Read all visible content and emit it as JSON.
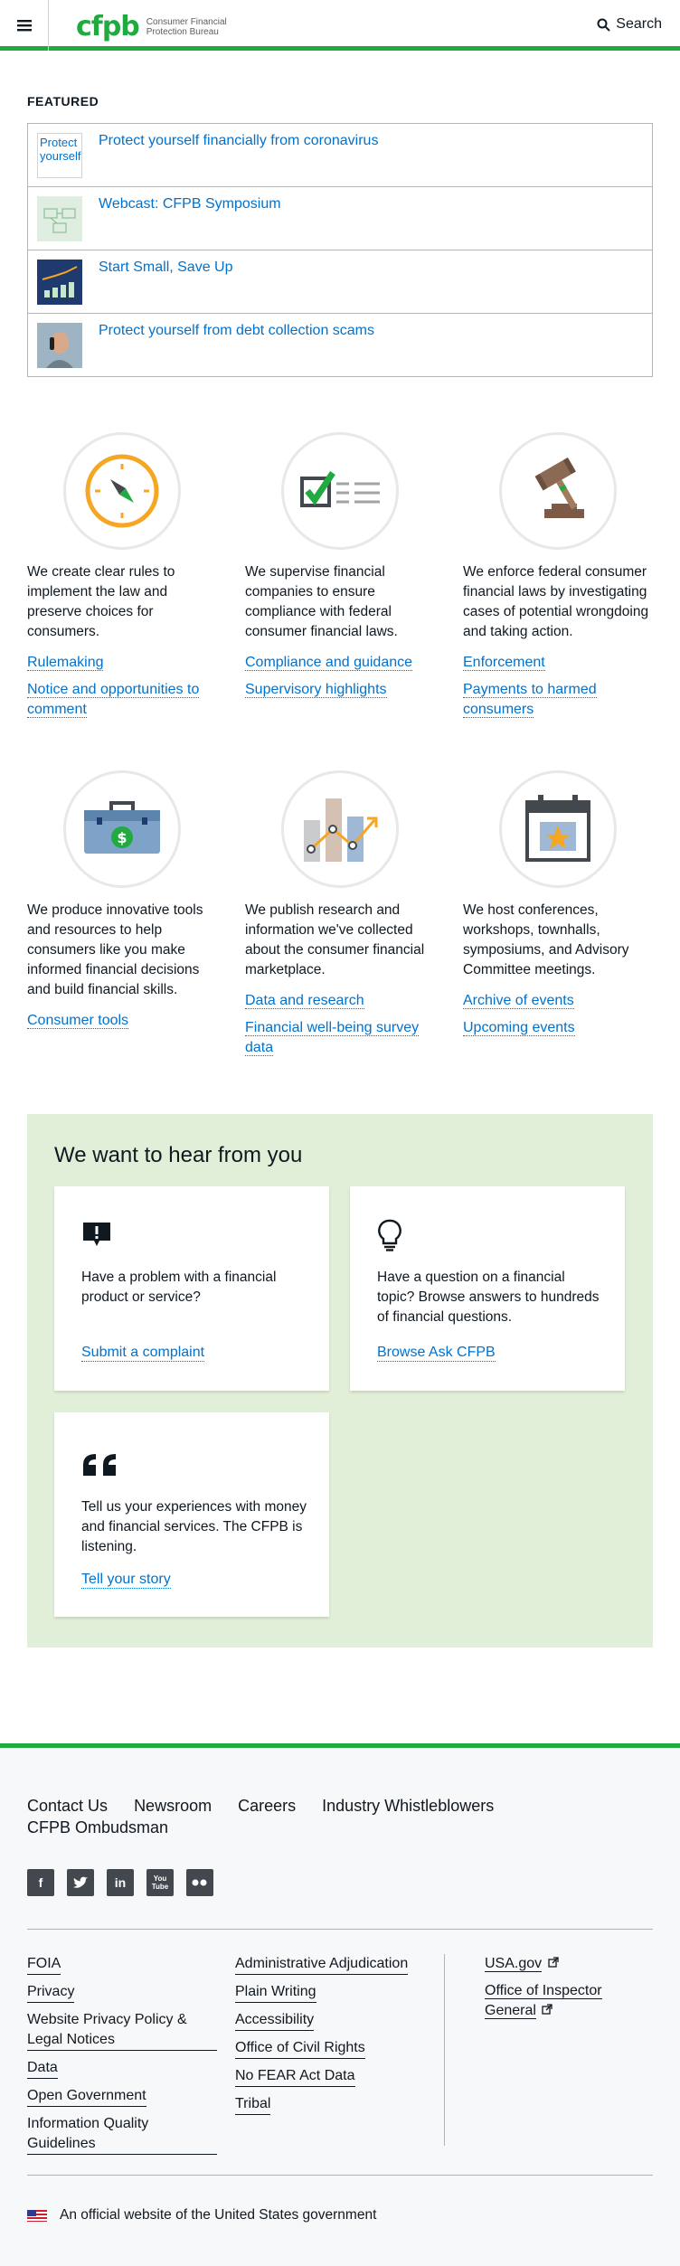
{
  "header": {
    "logo_mark": "cfpb",
    "logo_text": "Consumer Financial Protection Bureau",
    "search_label": "Search",
    "brand_color": "#20aa3f"
  },
  "featured": {
    "heading": "FEATURED",
    "items": [
      {
        "label": "Protect yourself financially from coronavirus",
        "thumb_alt": "Protect yourself"
      },
      {
        "label": "Webcast: CFPB Symposium"
      },
      {
        "label": "Start Small, Save Up"
      },
      {
        "label": "Protect yourself from debt collection scams"
      }
    ]
  },
  "cards": [
    {
      "icon": "compass-icon",
      "text": "We create clear rules to implement the law and preserve choices for consumers.",
      "links": [
        "Rulemaking",
        "Notice and opportunities to comment"
      ]
    },
    {
      "icon": "checklist-icon",
      "text": "We supervise financial companies to ensure compliance with federal consumer financial laws.",
      "links": [
        "Compliance and guidance",
        "Supervisory highlights"
      ]
    },
    {
      "icon": "gavel-icon",
      "text": "We enforce federal consumer financial laws by investigating cases of potential wrongdoing and taking action.",
      "links": [
        "Enforcement",
        "Payments to harmed consumers"
      ]
    },
    {
      "icon": "toolbox-icon",
      "text": "We produce innovative tools and resources to help consumers like you make informed financial decisions and build financial skills.",
      "links": [
        "Consumer tools"
      ]
    },
    {
      "icon": "bar-chart-icon",
      "text": "We publish research and information we've collected about the consumer financial marketplace.",
      "links": [
        "Data and research",
        "Financial well-being survey data"
      ]
    },
    {
      "icon": "calendar-icon",
      "text": "We host conferences, workshops, townhalls, symposiums, and Advisory Committee meetings.",
      "links": [
        "Archive of events",
        "Upcoming events"
      ]
    }
  ],
  "hear": {
    "title": "We want to hear from you",
    "cards": [
      {
        "icon": "alert-bubble-icon",
        "text": "Have a problem with a financial product or service?",
        "link": "Submit a complaint"
      },
      {
        "icon": "lightbulb-icon",
        "text": "Have a question on a financial topic? Browse answers to hundreds of financial questions.",
        "link": "Browse Ask CFPB"
      },
      {
        "icon": "quote-icon",
        "text": "Tell us your experiences with money and financial services. The CFPB is listening.",
        "link": "Tell your story"
      }
    ],
    "bg_color": "#e2efd8"
  },
  "footer": {
    "nav": [
      "Contact Us",
      "Newsroom",
      "Careers",
      "Industry Whistleblowers",
      "CFPB Ombudsman"
    ],
    "social": [
      "facebook-icon",
      "twitter-icon",
      "linkedin-icon",
      "youtube-icon",
      "flickr-icon"
    ],
    "col1": [
      "FOIA",
      "Privacy",
      "Website Privacy Policy & Legal Notices",
      "Data",
      "Open Government",
      "Information Quality Guidelines"
    ],
    "col2": [
      "Administrative Adjudication",
      "Plain Writing",
      "Accessibility",
      "Office of Civil Rights",
      "No FEAR Act Data",
      "Tribal"
    ],
    "col3": [
      "USA.gov",
      "Office of Inspector General"
    ],
    "gov_text": "An official website of the United States government"
  }
}
